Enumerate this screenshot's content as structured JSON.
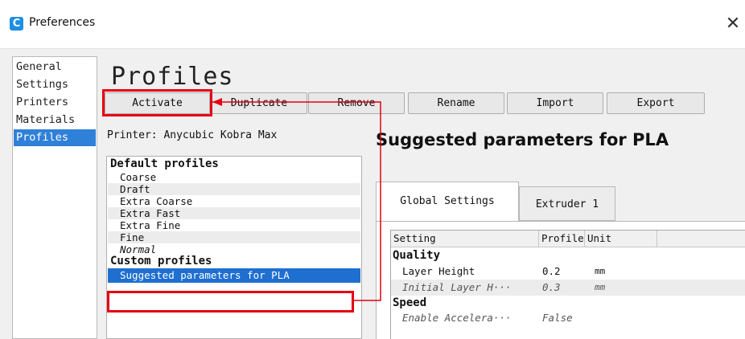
{
  "window": {
    "title": "Preferences",
    "icon_glyph": "C",
    "close_glyph": "✕"
  },
  "nav": {
    "items": [
      {
        "label": "General"
      },
      {
        "label": "Settings"
      },
      {
        "label": "Printers"
      },
      {
        "label": "Materials"
      },
      {
        "label": "Profiles",
        "active": true
      }
    ]
  },
  "page": {
    "title": "Profiles",
    "printer_label": "Printer: Anycubic Kobra Max"
  },
  "toolbar": {
    "activate": "Activate",
    "duplicate": "Duplicate",
    "remove": "Remove",
    "rename": "Rename",
    "import": "Import",
    "export": "Export"
  },
  "profiles": {
    "default_header": "Default profiles",
    "default_items": [
      "Coarse",
      "Draft",
      "Extra Coarse",
      "Extra Fast",
      "Extra Fine",
      "Fine",
      "Normal"
    ],
    "custom_header": "Custom profiles",
    "custom_items": [
      "Suggested parameters for PLA"
    ]
  },
  "details": {
    "title": "Suggested parameters for PLA",
    "tabs": [
      "Global Settings",
      "Extruder 1"
    ],
    "columns": [
      "Setting",
      "Profile",
      "Unit"
    ],
    "groups": [
      {
        "name": "Quality",
        "rows": [
          {
            "setting": "Layer Height",
            "profile": "0.2",
            "unit": "mm"
          },
          {
            "setting": "Initial Layer H···",
            "profile": "0.3",
            "unit": "mm"
          }
        ]
      },
      {
        "name": "Speed",
        "rows": [
          {
            "setting": "Enable Accelera···",
            "profile": "False",
            "unit": ""
          }
        ]
      }
    ]
  },
  "annotation_color": "#e60012",
  "accent_color": "#2f80d8"
}
